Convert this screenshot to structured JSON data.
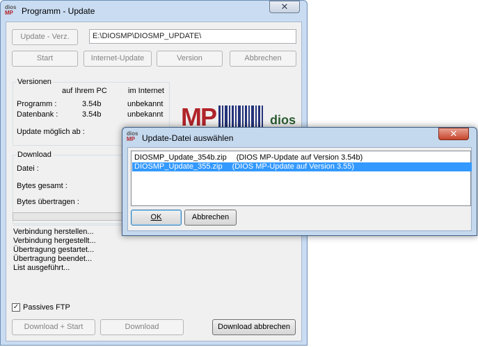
{
  "main_window": {
    "logo_top": "dios",
    "logo_bottom": "MP",
    "title": "Programm - Update",
    "close_glyph": "✕",
    "buttons": {
      "update_dir": "Update - Verz.",
      "start": "Start",
      "internet_update": "Internet-Update",
      "version": "Version",
      "abbrechen": "Abbrechen",
      "download_start": "Download + Start",
      "download": "Download",
      "download_abbrechen": "Download abbrechen"
    },
    "path_value": "E:\\DIOSMP\\DIOSMP_UPDATE\\",
    "versions": {
      "group_label": "Versionen",
      "col_pc": "auf Ihrem PC",
      "col_internet": "im Internet",
      "rows": [
        {
          "label": "Programm :",
          "pc": "3.54b",
          "internet": "unbekannt"
        },
        {
          "label": "Datenbank :",
          "pc": "3.54b",
          "internet": "unbekannt"
        }
      ],
      "update_possible_label": "Update möglich ab :"
    },
    "brand": {
      "mp": "MP",
      "dios": "dios"
    },
    "download_group": {
      "group_label": "Download",
      "file_label": "Datei :",
      "bytes_total_label": "Bytes gesamt :",
      "bytes_transferred_label": "Bytes übertragen :",
      "progress": 0
    },
    "log": [
      "Verbindung herstellen...",
      "Verbindung hergestellt...",
      "Übertragung gestartet...",
      "Übertragung beendet...",
      "List ausgeführt..."
    ],
    "passive_ftp": {
      "label": "Passives FTP",
      "checked": true,
      "check_glyph": "✓"
    }
  },
  "dialog": {
    "logo_top": "dios",
    "logo_bottom": "MP",
    "title": "Update-Datei auswählen",
    "close_glyph": "✕",
    "files": [
      {
        "name": "DIOSMP_Update_354b.zip",
        "desc": "(DIOS MP-Update auf Version 3.54b)",
        "selected": false
      },
      {
        "name": "DIOSMP_Update_355.zip",
        "desc": "(DIOS MP-Update auf Version 3.55)",
        "selected": true
      }
    ],
    "ok_label": "OK",
    "cancel_label": "Abbrechen"
  },
  "colors": {
    "selection": "#3399ff",
    "brand_red": "#b0242a",
    "brand_blue": "#24337a",
    "brand_green": "#2b5b30"
  }
}
